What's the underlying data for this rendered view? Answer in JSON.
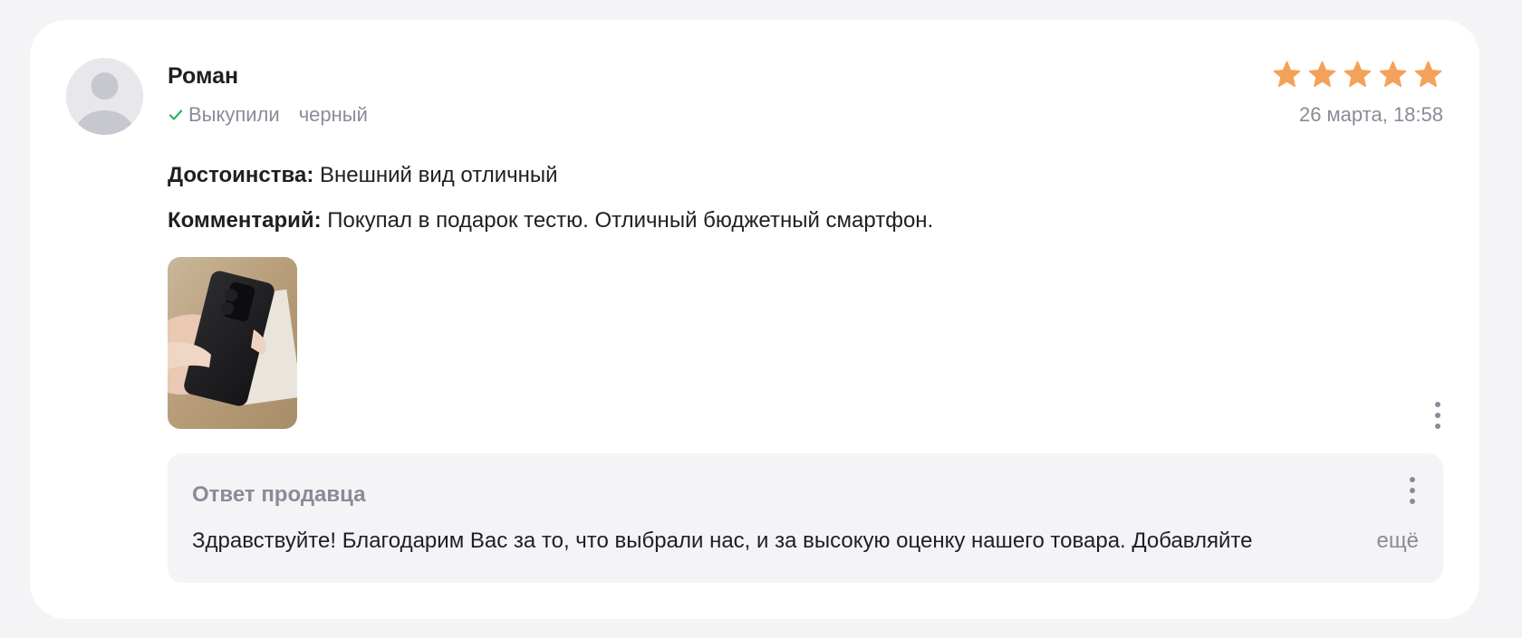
{
  "review": {
    "author": "Роман",
    "status": "Выкупили",
    "variant": "черный",
    "rating": 5,
    "rating_max": 5,
    "date": "26 марта, 18:58",
    "pros_label": "Достоинства:",
    "pros_text": "Внешний вид отличный",
    "comment_label": "Комментарий:",
    "comment_text": "Покупал в подарок тестю. Отличный бюджетный смартфон."
  },
  "seller_reply": {
    "title": "Ответ продавца",
    "text": "Здравствуйте! Благодарим Вас за то, что выбрали нас, и за высокую оценку нашего товара. Добавляйте",
    "more_label": "ещё"
  },
  "icons": {
    "avatar": "user-placeholder-icon",
    "status": "check-icon",
    "rating": "star-icon",
    "menu": "more-vertical-icon"
  },
  "colors": {
    "star": "#f4a259",
    "check": "#2fb35f",
    "muted_text": "#8b8b98",
    "card_background": "#ffffff",
    "page_background": "#f4f4f6"
  }
}
